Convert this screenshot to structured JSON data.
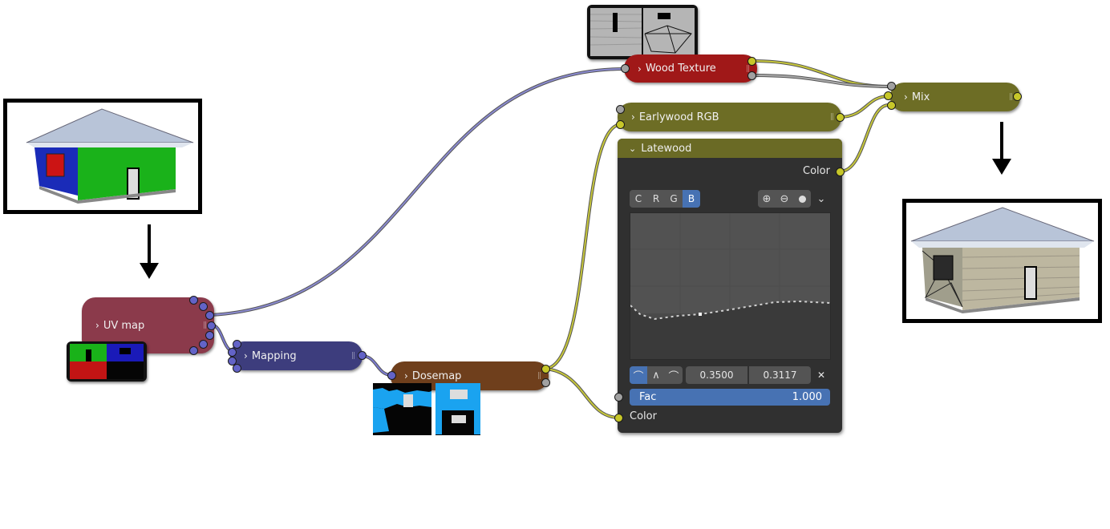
{
  "nodes": {
    "uv_map": {
      "label": "UV map"
    },
    "mapping": {
      "label": "Mapping"
    },
    "dosemap": {
      "label": "Dosemap"
    },
    "wood_texture": {
      "label": "Wood Texture"
    },
    "earlywood_rgb": {
      "label": "Earlywood RGB"
    },
    "mix": {
      "label": "Mix"
    },
    "latewood": {
      "title": "Latewood",
      "output_label": "Color",
      "channels": [
        "C",
        "R",
        "G",
        "B"
      ],
      "active_channel": "B",
      "point_x": "0.3500",
      "point_y": "0.3117",
      "fac_label": "Fac",
      "fac_value": "1.000",
      "input_color_label": "Color"
    }
  },
  "colors": {
    "uv_map": "#8b3a4b",
    "mapping": "#3d3d7d",
    "dosemap": "#6f3f1c",
    "wood_texture": "#a01818",
    "earlywood_rgb": "#6d6d25",
    "mix": "#6d6d25",
    "wire_color": "#b6b63a",
    "wire_vector": "#6f6fbf",
    "wire_gray": "#9a9a9a"
  },
  "icons": {
    "chevron": "›",
    "grip": "||",
    "zoom_in": "⊕",
    "zoom_out": "⊖",
    "close": "✕",
    "dropdown": "⌄"
  }
}
